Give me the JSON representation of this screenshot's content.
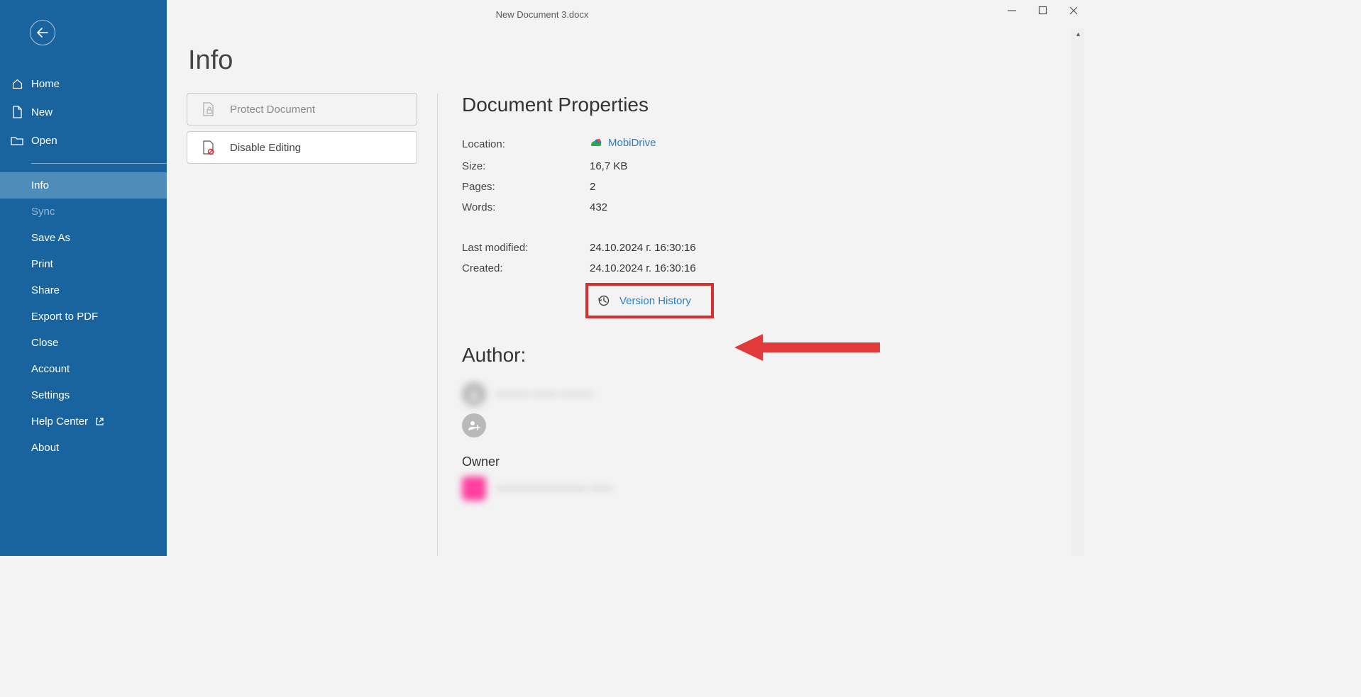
{
  "window": {
    "title": "New Document 3.docx"
  },
  "sidebar": {
    "items": [
      {
        "label": "Home"
      },
      {
        "label": "New"
      },
      {
        "label": "Open"
      },
      {
        "label": "Info"
      },
      {
        "label": "Sync"
      },
      {
        "label": "Save As"
      },
      {
        "label": "Print"
      },
      {
        "label": "Share"
      },
      {
        "label": "Export to PDF"
      },
      {
        "label": "Close"
      },
      {
        "label": "Account"
      },
      {
        "label": "Settings"
      },
      {
        "label": "Help Center"
      },
      {
        "label": "About"
      }
    ]
  },
  "page": {
    "title": "Info",
    "actions": {
      "protect": "Protect Document",
      "disable_editing": "Disable Editing"
    },
    "properties_heading": "Document Properties",
    "props": {
      "location_label": "Location:",
      "location_value": "MobiDrive",
      "size_label": "Size:",
      "size_value": "16,7 KB",
      "pages_label": "Pages:",
      "pages_value": "2",
      "words_label": "Words:",
      "words_value": "432",
      "modified_label": "Last modified:",
      "modified_value": "24.10.2024 г. 16:30:16",
      "created_label": "Created:",
      "created_value": "24.10.2024 г. 16:30:16",
      "version_history": "Version History"
    },
    "author_heading": "Author:",
    "author_name": "———  ——  ———",
    "owner_heading": "Owner",
    "owner_name": "————————   ——"
  }
}
